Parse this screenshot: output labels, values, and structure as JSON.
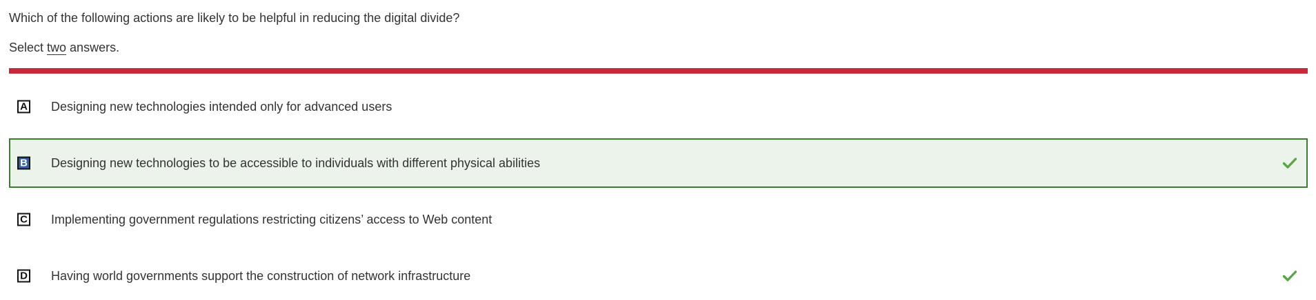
{
  "question": {
    "text": "Which of the following actions are likely to be helpful in reducing the digital divide?",
    "instruction_prefix": "Select ",
    "instruction_emphasis": "two",
    "instruction_suffix": " answers."
  },
  "colors": {
    "divider": "#c8283a",
    "selected_background": "#ebf3ea",
    "selected_border": "#3a7d2e",
    "selected_letter_fill": "#2f5fad",
    "check": "#5aa646"
  },
  "options": [
    {
      "letter": "A",
      "text": "Designing new technologies intended only for advanced users",
      "selected": false,
      "correct": false
    },
    {
      "letter": "B",
      "text": "Designing new technologies to be accessible to individuals with different physical abilities",
      "selected": true,
      "correct": true,
      "icon": "check-icon"
    },
    {
      "letter": "C",
      "text": "Implementing government regulations restricting citizens’ access to Web content",
      "selected": false,
      "correct": false
    },
    {
      "letter": "D",
      "text": "Having world governments support the construction of network infrastructure",
      "selected": false,
      "correct": true,
      "icon": "check-icon"
    }
  ]
}
